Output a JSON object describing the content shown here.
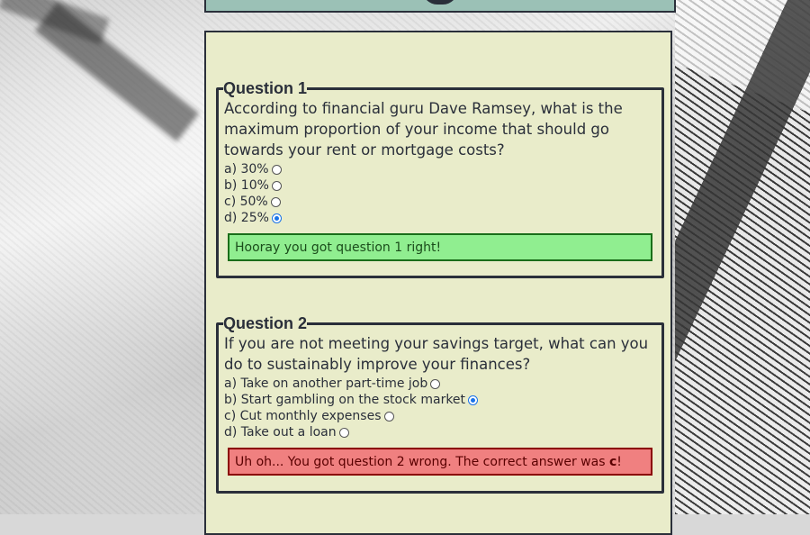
{
  "quiz": {
    "questions": [
      {
        "legend": "Question 1",
        "text": "According to financial guru Dave Ramsey, what is the maximum proportion of your income that should go towards your rent or mortgage costs?",
        "options": [
          {
            "label": "a) 30%",
            "checked": false
          },
          {
            "label": "b) 10%",
            "checked": false
          },
          {
            "label": "c) 50%",
            "checked": false
          },
          {
            "label": "d) 25%",
            "checked": true
          }
        ],
        "feedback": "Hooray you got question 1 right!",
        "feedback_status": "correct"
      },
      {
        "legend": "Question 2",
        "text": "If you are not meeting your savings target, what can you do to sustainably improve your finances?",
        "options": [
          {
            "label": "a) Take on another part-time job",
            "checked": false
          },
          {
            "label": "b) Start gambling on the stock market",
            "checked": true
          },
          {
            "label": "c) Cut monthly expenses",
            "checked": false
          },
          {
            "label": "d) Take out a loan",
            "checked": false
          }
        ],
        "feedback_prefix": "Uh oh... You got question 2 wrong. The correct answer was ",
        "feedback_answer": "c",
        "feedback_suffix": "!",
        "feedback_status": "incorrect"
      }
    ]
  },
  "colors": {
    "panel_bg": "#e9ecca",
    "header_bg": "#9bc1b6",
    "correct_bg": "#90ee90",
    "incorrect_bg": "#f08080",
    "accent": "#1a73e8"
  }
}
